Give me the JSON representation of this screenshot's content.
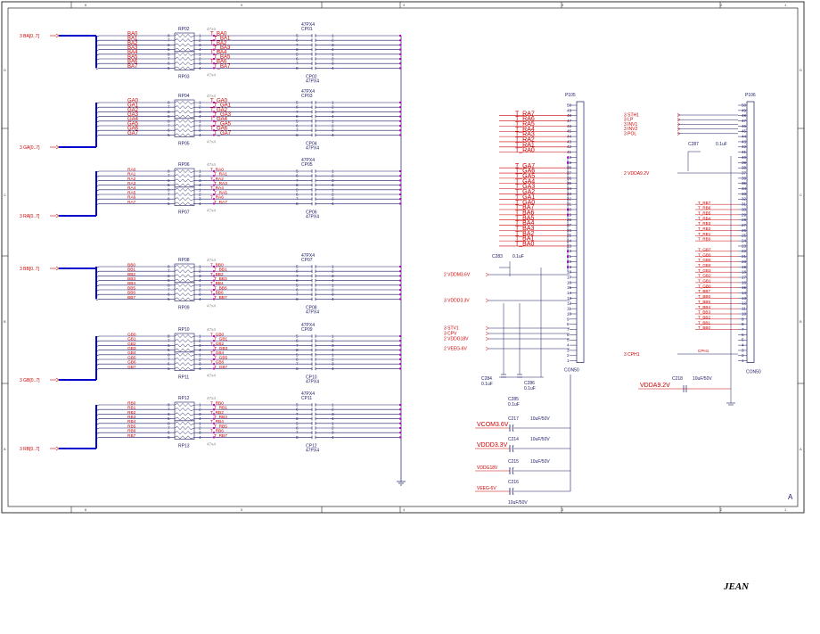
{
  "sheet": {
    "border_cols_top": [
      "6",
      "5",
      "4",
      "3",
      "2",
      "1"
    ],
    "border_cols_bottom": [
      "6",
      "5",
      "4",
      "3",
      "2",
      "1"
    ],
    "border_rows": [
      "D",
      "C",
      "B",
      "A"
    ],
    "rev_letter": "A",
    "author": "JEAN"
  },
  "buses": [
    {
      "ref": "3",
      "name": "BA[0..7]"
    },
    {
      "ref": "3",
      "name": "GA[0..7]"
    },
    {
      "ref": "3",
      "name": "RA[0..7]"
    },
    {
      "ref": "3",
      "name": "BB[0..7]"
    },
    {
      "ref": "3",
      "name": "GB[0..7]"
    },
    {
      "ref": "3",
      "name": "RB[0..7]"
    }
  ],
  "blocks": [
    {
      "bus_sig": [
        "BA0",
        "BA1",
        "BA2",
        "BA3",
        "BA4",
        "BA5",
        "BA6",
        "BA7"
      ],
      "t_sig": [
        "T_BA0",
        "T_BA1",
        "T_BA2",
        "T_BA3",
        "T_BA4",
        "T_BA5",
        "T_BA6",
        "T_BA7"
      ],
      "rp_top": "RP02",
      "rp_bot": "RP03",
      "cp_top": "CP01",
      "cp_bot": "CP02",
      "rp_val": "47x4",
      "cp_val": "47PX4"
    },
    {
      "bus_sig": [
        "GA0",
        "GA1",
        "GA2",
        "GA3",
        "GA4",
        "GA5",
        "GA6",
        "GA7"
      ],
      "t_sig": [
        "T_GA0",
        "T_GA1",
        "T_GA2",
        "T_GA3",
        "T_GA4",
        "T_GA5",
        "T_GA6",
        "T_GA7"
      ],
      "rp_top": "RP04",
      "rp_bot": "RP05",
      "cp_top": "CP03",
      "cp_bot": "CP04",
      "rp_val": "47x4",
      "cp_val": "47PX4"
    },
    {
      "bus_sig": [
        "RA0",
        "RA1",
        "RA2",
        "RA3",
        "RA4",
        "RA5",
        "RA6",
        "RA7"
      ],
      "t_sig": [
        "T_RA0",
        "T_RA1",
        "T_RA2",
        "T_RA3",
        "T_RA4",
        "T_RA5",
        "T_RA6",
        "T_RA7"
      ],
      "rp_top": "RP06",
      "rp_bot": "RP07",
      "cp_top": "CP05",
      "cp_bot": "CP06",
      "rp_val": "47x4",
      "cp_val": "47PX4"
    },
    {
      "bus_sig": [
        "BB0",
        "BB1",
        "BB2",
        "BB3",
        "BB4",
        "BB5",
        "BB6",
        "BB7"
      ],
      "t_sig": [
        "T_BB0",
        "T_BB1",
        "T_BB2",
        "T_BB3",
        "T_BB4",
        "T_BB5",
        "T_BB6",
        "T_BB7"
      ],
      "rp_top": "RP08",
      "rp_bot": "RP09",
      "cp_top": "CP07",
      "cp_bot": "CP08",
      "rp_val": "47x4",
      "cp_val": "47PX4"
    },
    {
      "bus_sig": [
        "GB0",
        "GB1",
        "GB2",
        "GB3",
        "GB4",
        "GB5",
        "GB6",
        "GB7"
      ],
      "t_sig": [
        "T_GB0",
        "T_GB1",
        "T_GB2",
        "T_GB3",
        "T_GB4",
        "T_GB5",
        "T_GB6",
        "T_GB7"
      ],
      "rp_top": "RP10",
      "rp_bot": "RP11",
      "cp_top": "CP09",
      "cp_bot": "CP10",
      "rp_val": "47x4",
      "cp_val": "47PX4"
    },
    {
      "bus_sig": [
        "RB0",
        "RB1",
        "RB2",
        "RB3",
        "RB4",
        "RB5",
        "RB6",
        "RB7"
      ],
      "t_sig": [
        "T_RB0",
        "T_RB1",
        "T_RB2",
        "T_RB3",
        "T_RB4",
        "T_RB5",
        "T_RB6",
        "T_RB7"
      ],
      "rp_top": "RP12",
      "rp_bot": "RP13",
      "cp_top": "CP11",
      "cp_bot": "CP12",
      "rp_val": "47x4",
      "cp_val": "47PX4"
    }
  ],
  "p105": {
    "ref": "P105",
    "part": "CON50",
    "pins": [
      "50",
      "49",
      "48",
      "47",
      "46",
      "45",
      "44",
      "43",
      "42",
      "41",
      "40",
      "39",
      "38",
      "37",
      "36",
      "35",
      "34",
      "33",
      "32",
      "31",
      "30",
      "29",
      "28",
      "27",
      "26",
      "25",
      "24",
      "23",
      "22",
      "21",
      "20",
      "19",
      "18",
      "17",
      "16",
      "15",
      "14",
      "13",
      "12",
      "11",
      "10",
      "9",
      "8",
      "7",
      "6",
      "5",
      "4",
      "3",
      "2",
      "1"
    ],
    "a_signals": [
      "T_RA7",
      "T_RA6",
      "T_RA5",
      "T_RA4",
      "T_RA3",
      "T_RA2",
      "T_RA1",
      "T_RA0"
    ],
    "g_signals": [
      "T_GA7",
      "T_GA6",
      "T_GA5",
      "T_GA4",
      "T_GA3",
      "T_GA2",
      "T_GA1",
      "T_GA0"
    ],
    "b_signals": [
      "T_BA7",
      "T_BA6",
      "T_BA5",
      "T_BA4",
      "T_BA3",
      "T_BA2",
      "T_BA1",
      "T_BA0"
    ],
    "power": [
      {
        "ref": "2",
        "name": "VDDM3.6V"
      },
      {
        "ref": "3",
        "name": "VDDD3.3V"
      },
      {
        "ref": "3",
        "name": "STV1"
      },
      {
        "ref": "3",
        "name": "CPV"
      },
      {
        "ref": "2",
        "name": "VDDG18V"
      },
      {
        "ref": "2",
        "name": "VEEG-6V"
      }
    ],
    "caps": [
      {
        "ref": "C283",
        "val": "0.1uF"
      },
      {
        "ref": "C284",
        "val": "0.1uF"
      },
      {
        "ref": "C285",
        "val": "0.1uF"
      },
      {
        "ref": "C286",
        "val": "0.1uF"
      }
    ]
  },
  "p106": {
    "ref": "P106",
    "part": "CON50",
    "ctrl": [
      {
        "ref": "3",
        "name": "STH1"
      },
      {
        "ref": "3",
        "name": "LP"
      },
      {
        "ref": "3",
        "name": "INV1"
      },
      {
        "ref": "3",
        "name": "INV2"
      },
      {
        "ref": "3",
        "name": "POL"
      }
    ],
    "vdda": {
      "ref": "2",
      "name": "VDDA9.2V"
    },
    "cph": {
      "ref": "3",
      "name": "CPH1"
    },
    "cap_c287": {
      "ref": "C287",
      "val": "0.1uF"
    },
    "r_signals": [
      "T_RB7",
      "T_RB6",
      "T_RB5",
      "T_RB4",
      "T_RB3",
      "T_RB2",
      "T_RB1",
      "T_RB0"
    ],
    "g_signals": [
      "T_GB7",
      "T_GB6",
      "T_GB5",
      "T_GB4",
      "T_GB3",
      "T_GB2",
      "T_GB1",
      "T_GB0"
    ],
    "b_signals": [
      "T_BB7",
      "T_BB6",
      "T_BB5",
      "T_BB4",
      "T_BB3",
      "T_BB2",
      "T_BB1",
      "T_BB0"
    ],
    "vdda_label": "VDDA9.2V",
    "cap_c218": {
      "ref": "C218",
      "val": "10uF/50V"
    }
  },
  "bulk_caps": [
    {
      "net": "VCOM3.6V",
      "ref": "C217",
      "val": "10uF/50V"
    },
    {
      "net": "VDDD3.3V",
      "ref": "C214",
      "val": "10uF/50V"
    },
    {
      "net": "VDDG18V",
      "ref": "C215",
      "val": "10uF/50V"
    },
    {
      "net": "VEEG-6V",
      "ref": "C216",
      "val": "10uF/50V"
    }
  ],
  "colors": {
    "wire": "#1a1a66",
    "signal": "#cc0000",
    "junction": "#cc00cc",
    "bus": "#0000cc"
  }
}
